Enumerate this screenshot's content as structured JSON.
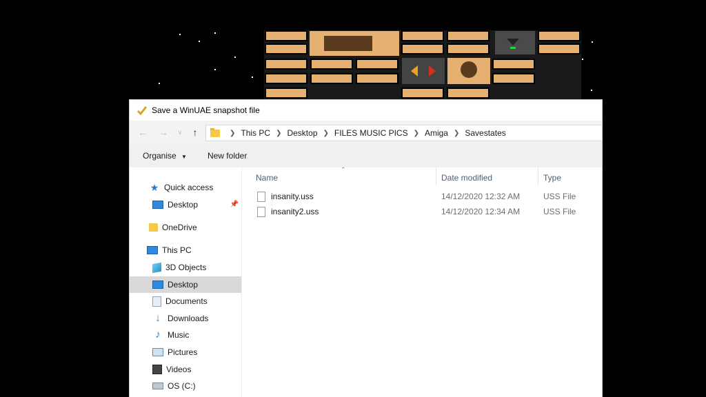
{
  "dialog": {
    "title": "Save a WinUAE snapshot file"
  },
  "nav": {
    "back_icon": "arrow-left-icon",
    "forward_icon": "arrow-right-icon",
    "recent_icon": "chevron-down-icon",
    "up_icon": "arrow-up-icon"
  },
  "breadcrumb": {
    "items": [
      "This PC",
      "Desktop",
      "FILES MUSIC PICS",
      "Amiga",
      "Savestates"
    ]
  },
  "toolbar": {
    "organise_label": "Organise",
    "new_folder_label": "New folder"
  },
  "sidebar": {
    "items": [
      {
        "label": "Quick access",
        "icon": "star-icon"
      },
      {
        "label": "Desktop",
        "icon": "desktop-icon"
      },
      {
        "label": "OneDrive",
        "icon": "folder-icon"
      },
      {
        "label": "This PC",
        "icon": "monitor-icon"
      },
      {
        "label": "3D Objects",
        "icon": "cube-icon"
      },
      {
        "label": "Desktop",
        "icon": "desktop-icon"
      },
      {
        "label": "Documents",
        "icon": "document-icon"
      },
      {
        "label": "Downloads",
        "icon": "download-icon"
      },
      {
        "label": "Music",
        "icon": "music-icon"
      },
      {
        "label": "Pictures",
        "icon": "pictures-icon"
      },
      {
        "label": "Videos",
        "icon": "video-icon"
      },
      {
        "label": "OS (C:)",
        "icon": "drive-icon"
      }
    ]
  },
  "columns": {
    "name": "Name",
    "date": "Date modified",
    "type": "Type"
  },
  "files": [
    {
      "name": "insanity.uss",
      "date": "14/12/2020 12:32 AM",
      "type": "USS File"
    },
    {
      "name": "insanity2.uss",
      "date": "14/12/2020 12:34 AM",
      "type": "USS File"
    }
  ],
  "colors": {
    "selected_bg": "#d9d9d9",
    "folder": "#f5c84c",
    "accent": "#2e8ae0"
  }
}
